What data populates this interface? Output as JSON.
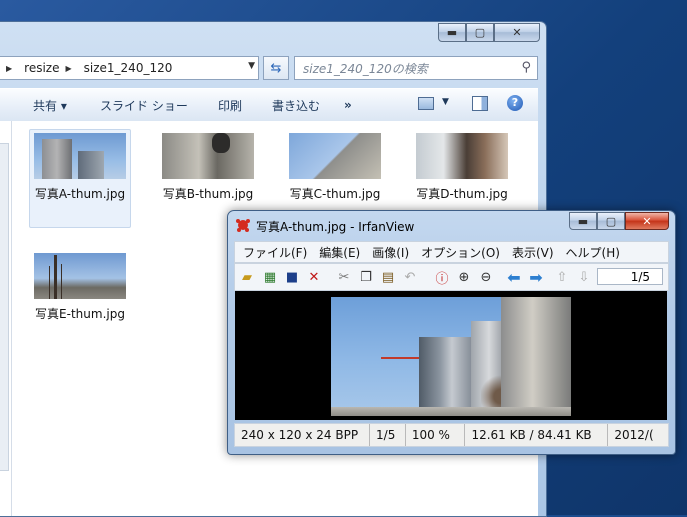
{
  "explorer": {
    "breadcrumb": [
      "resize",
      "size1_240_120"
    ],
    "search_placeholder": "size1_240_120の検索",
    "commands": {
      "share": "共有 ▾",
      "slideshow": "スライド ショー",
      "print": "印刷",
      "burn": "書き込む",
      "more": "»"
    },
    "help": "?",
    "files": [
      {
        "name": "写真A-thum.jpg",
        "selected": true
      },
      {
        "name": "写真B-thum.jpg",
        "selected": false
      },
      {
        "name": "写真C-thum.jpg",
        "selected": false
      },
      {
        "name": "写真D-thum.jpg",
        "selected": false
      },
      {
        "name": "写真E-thum.jpg",
        "selected": false
      }
    ]
  },
  "irfanview": {
    "title": "写真A-thum.jpg - IrfanView",
    "menu": [
      "ファイル(F)",
      "編集(E)",
      "画像(I)",
      "オプション(O)",
      "表示(V)",
      "ヘルプ(H)"
    ],
    "page_indicator": "1/5",
    "status": {
      "dimensions": "240 x 120 x 24 BPP",
      "index": "1/5",
      "zoom": "100 %",
      "size": "12.61 KB / 84.41 KB",
      "date": "2012/("
    }
  },
  "caption_buttons": {
    "minimize": "▬",
    "maximize": "▢",
    "close": "✕"
  }
}
